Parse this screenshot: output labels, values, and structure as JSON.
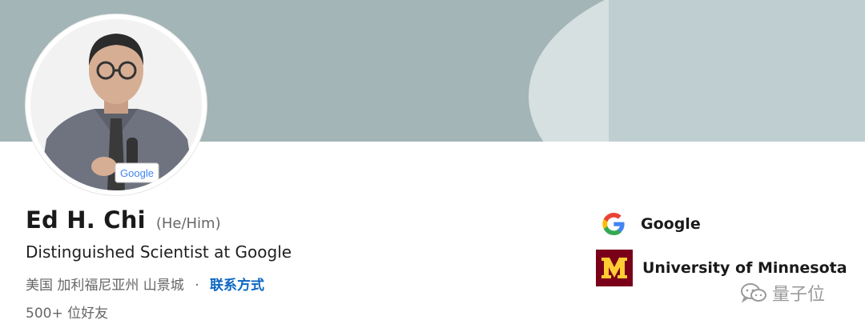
{
  "profile": {
    "name": "Ed H. Chi",
    "pronouns": "(He/Him)",
    "headline": "Distinguished Scientist at Google",
    "location": "美国 加利福尼亚州 山景城",
    "separator": "·",
    "contact_link": "联系方式",
    "connections": "500+ 位好友",
    "photo_badge_text": "Google"
  },
  "organizations": [
    {
      "name": "Google",
      "icon": "google-logo-icon"
    },
    {
      "name": "University of Minnesota",
      "icon": "university-of-minnesota-logo-icon",
      "logo_letter": "M"
    }
  ],
  "watermark": {
    "text": "量子位",
    "icon": "wechat-icon"
  },
  "colors": {
    "cover": "#a3b5b6",
    "link": "#0a66c2",
    "umn_maroon": "#7a0019",
    "umn_gold": "#ffcc33"
  }
}
